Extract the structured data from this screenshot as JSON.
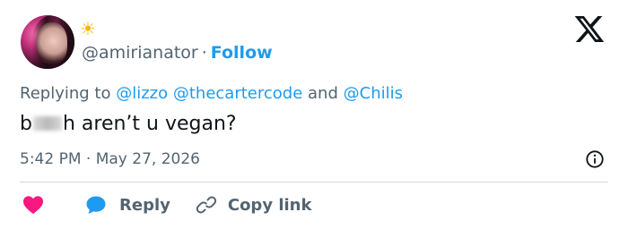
{
  "author": {
    "handle": "@amirianator",
    "separator": "·",
    "follow_label": "Follow",
    "status_emoji": "☀"
  },
  "reply_context": {
    "prefix": "Replying to",
    "mentions": [
      "@lizzo",
      "@thecartercode",
      "@Chilis"
    ],
    "joiner": "and"
  },
  "tweet": {
    "text_start": "b",
    "text_end": "h aren’t u vegan?"
  },
  "meta": {
    "time": "5:42 PM",
    "separator": "·",
    "date": "May 27, 2026"
  },
  "actions": {
    "reply_label": "Reply",
    "copy_link_label": "Copy link"
  },
  "colors": {
    "accent": "#1d9bf0",
    "like": "#f91880",
    "secondary_text": "#536471"
  },
  "icons": {
    "logo": "x-logo-icon",
    "info": "info-icon",
    "like": "heart-icon",
    "reply": "speech-bubble-icon",
    "copy": "link-icon"
  }
}
